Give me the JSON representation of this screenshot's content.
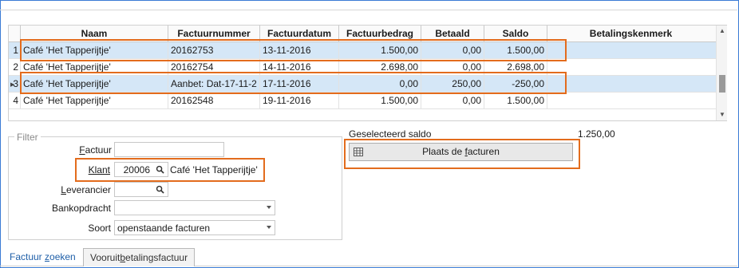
{
  "grid": {
    "columns": [
      "",
      "Naam",
      "Factuurnummer",
      "Factuurdatum",
      "Factuurbedrag",
      "Betaald",
      "Saldo",
      "Betalingskenmerk"
    ],
    "rows": [
      {
        "nr": "1",
        "naam": "Café 'Het Tapperijtje'",
        "factuurnummer": "20162753",
        "factuurdatum": "13-11-2016",
        "factuurbedrag": "1.500,00",
        "betaald": "0,00",
        "saldo": "1.500,00",
        "betalingskenmerk": "",
        "selected": true
      },
      {
        "nr": "2",
        "naam": "Café 'Het Tapperijtje'",
        "factuurnummer": "20162754",
        "factuurdatum": "14-11-2016",
        "factuurbedrag": "2.698,00",
        "betaald": "0,00",
        "saldo": "2.698,00",
        "betalingskenmerk": "",
        "selected": false
      },
      {
        "nr": "3",
        "naam": "Café 'Het Tapperijtje'",
        "factuurnummer": "Aanbet: Dat-17-11-2",
        "factuurdatum": "17-11-2016",
        "factuurbedrag": "0,00",
        "betaald": "250,00",
        "saldo": "-250,00",
        "betalingskenmerk": "",
        "selected": true
      },
      {
        "nr": "4",
        "naam": "Café 'Het Tapperijtje'",
        "factuurnummer": "20162548",
        "factuurdatum": "19-11-2016",
        "factuurbedrag": "1.500,00",
        "betaald": "0,00",
        "saldo": "1.500,00",
        "betalingskenmerk": "",
        "selected": false
      }
    ]
  },
  "filter": {
    "title": "Filter",
    "factuur": {
      "label_underlined": "F",
      "label_rest": "actuur",
      "value": ""
    },
    "klant": {
      "label": "Klant",
      "code": "20006",
      "name": "Café 'Het Tapperijtje'"
    },
    "leverancier": {
      "label_underlined": "L",
      "label_rest": "everancier",
      "value": ""
    },
    "bankopdracht": {
      "label": "Bankopdracht",
      "value": ""
    },
    "soort": {
      "label": "Soort",
      "value": "openstaande facturen"
    }
  },
  "summary": {
    "label": "Geselecteerd saldo",
    "value": "1.250,00",
    "button_pre": "Plaats de ",
    "button_underlined": "f",
    "button_post": "acturen"
  },
  "tabs": {
    "active_pre": "Factuur ",
    "active_underlined": "z",
    "active_post": "oeken",
    "inactive_pre": "Vooruit",
    "inactive_underlined": "b",
    "inactive_post": "etalingsfactuur"
  },
  "colors": {
    "accent": "#e36c1d",
    "selection": "#d5e7f7",
    "window_border": "#3a7bd5"
  }
}
